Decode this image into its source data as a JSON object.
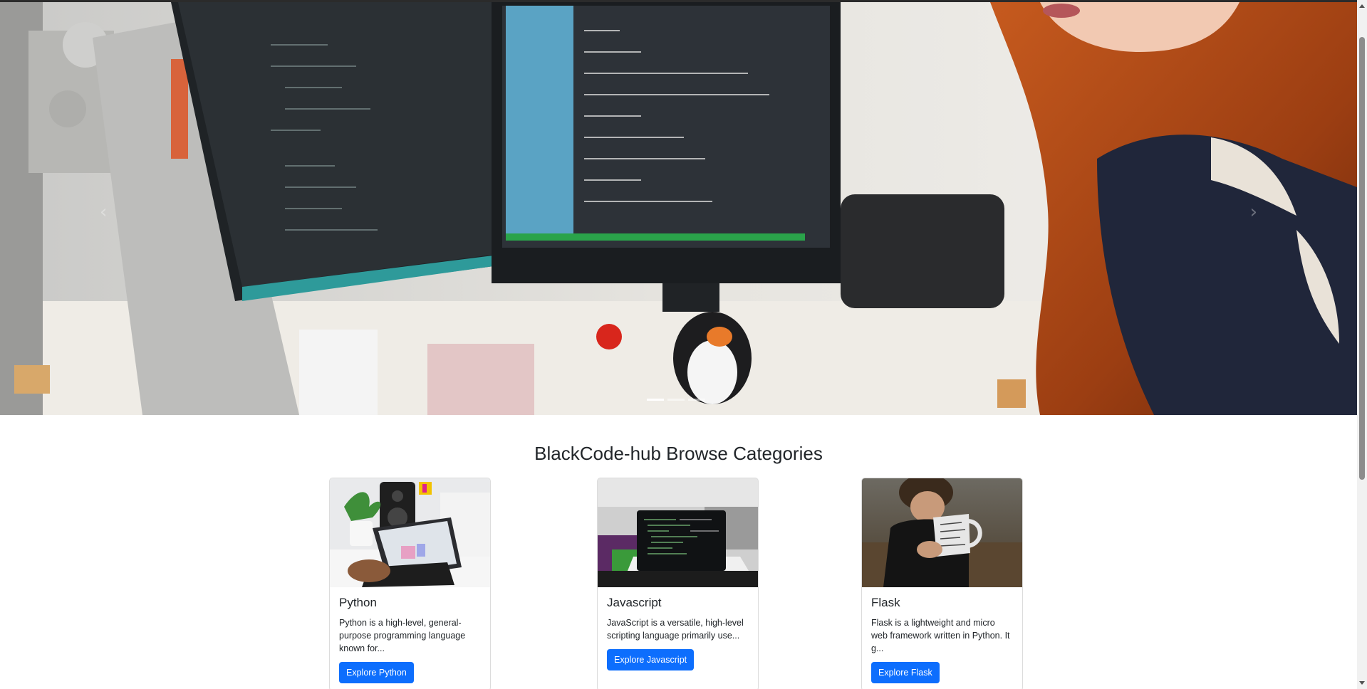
{
  "carousel": {
    "prev_label": "‹",
    "next_label": "›",
    "indicators": [
      {
        "label": "Slide 1",
        "active": true
      },
      {
        "label": "Slide 2",
        "active": false
      },
      {
        "label": "Slide 3",
        "active": false
      }
    ]
  },
  "section": {
    "title": "BlackCode-hub Browse Categories"
  },
  "cards": [
    {
      "title": "Python",
      "text": "Python is a high-level, general-purpose programming language known for...",
      "button": "Explore Python"
    },
    {
      "title": "Javascript",
      "text": "JavaScript is a versatile, high-level scripting language primarily use...",
      "button": "Explore Javascript"
    },
    {
      "title": "Flask",
      "text": "Flask is a lightweight and micro web framework written in Python. It g...",
      "button": "Explore Flask"
    }
  ],
  "colors": {
    "primary_button": "#0d6efd",
    "heading_text": "#212529"
  }
}
